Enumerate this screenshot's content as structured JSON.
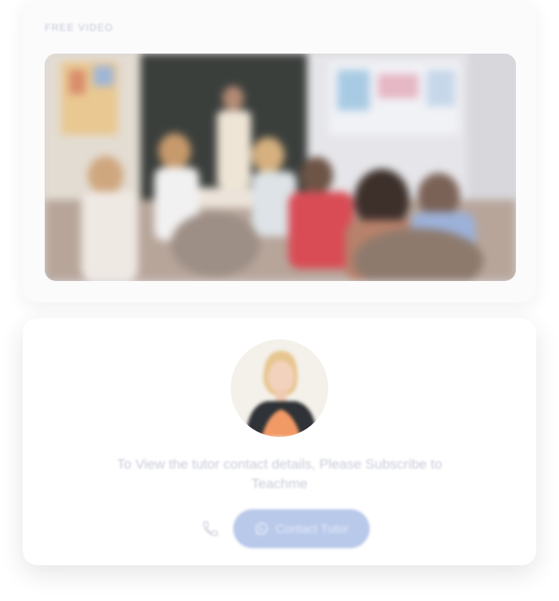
{
  "video_section": {
    "label": "FREE VIDEO"
  },
  "tutor_section": {
    "message": "To View the tutor contact details, Please Subscribe to Teachme",
    "contact_button_label": "Contact Tutor"
  },
  "icons": {
    "phone": "phone-icon",
    "whatsapp": "whatsapp-icon"
  },
  "colors": {
    "button_bg": "#b9c9ea",
    "muted_text": "#c9ccd9"
  }
}
